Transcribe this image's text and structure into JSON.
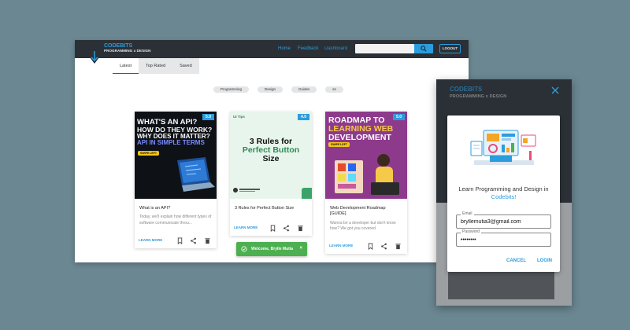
{
  "desktop": {
    "brand": {
      "title": "CODEBITS",
      "subtitle": "PROGRAMMING x DESIGN"
    },
    "nav": {
      "home": "Home",
      "feedback": "Feedback",
      "dashboard": "Dashboard"
    },
    "search": {
      "placeholder": ""
    },
    "logout_label": "LOGOUT",
    "tabs": [
      {
        "label": "Latest"
      },
      {
        "label": "Top Rated"
      },
      {
        "label": "Saved"
      }
    ],
    "chips": [
      {
        "label": "Programming"
      },
      {
        "label": "Design"
      },
      {
        "label": "Guides"
      },
      {
        "label": "ss"
      }
    ],
    "cards": [
      {
        "rating": "5.0",
        "thumb_lines": [
          "WHAT'S AN API?",
          "HOW DO THEY WORK?",
          "WHY DOES IT MATTER?",
          "API IN SIMPLE TERMS"
        ],
        "swipe": "SWIPE LEFT",
        "title": "What is an API?",
        "description": "Today, we'll explain how different types of software communicate throu...",
        "learn_more": "LEARN MORE"
      },
      {
        "rating": "4.0",
        "thumb_tag": "UI Tips",
        "thumb_lines": [
          "3 Rules for",
          "Perfect Button",
          "Size"
        ],
        "title": "3 Rules for Perfect Button Size",
        "description": "",
        "learn_more": "LEARN MORE"
      },
      {
        "rating": "5.0",
        "thumb_lines": [
          "ROADMAP TO",
          "LEARNING WEB",
          "DEVELOPMENT"
        ],
        "swipe": "SWIPE LEFT",
        "title": "Web Development Roadmap [GUIDE]",
        "description": "Wanna be a developer but don't know how? We got you covered.",
        "learn_more": "LEARN MORE"
      }
    ],
    "toast": {
      "message": "Welcome, Brylle Mutia",
      "close": "×"
    }
  },
  "mobile": {
    "brand": {
      "title": "CODEBITS",
      "subtitle": "PROGRAMMING x DESIGN"
    },
    "dialog": {
      "heading": "Learn Programming and Design in",
      "heading_accent": "Codebits!",
      "email_label": "Email",
      "email_value": "bryllemutia3@gmail.com",
      "password_label": "Password",
      "password_value": "••••••••",
      "cancel_label": "CANCEL",
      "login_label": "LOGIN"
    }
  },
  "colors": {
    "accent": "#2b9cde",
    "topbar": "#2a3035",
    "toast": "#4caf50",
    "backdrop": "#6b8791"
  }
}
